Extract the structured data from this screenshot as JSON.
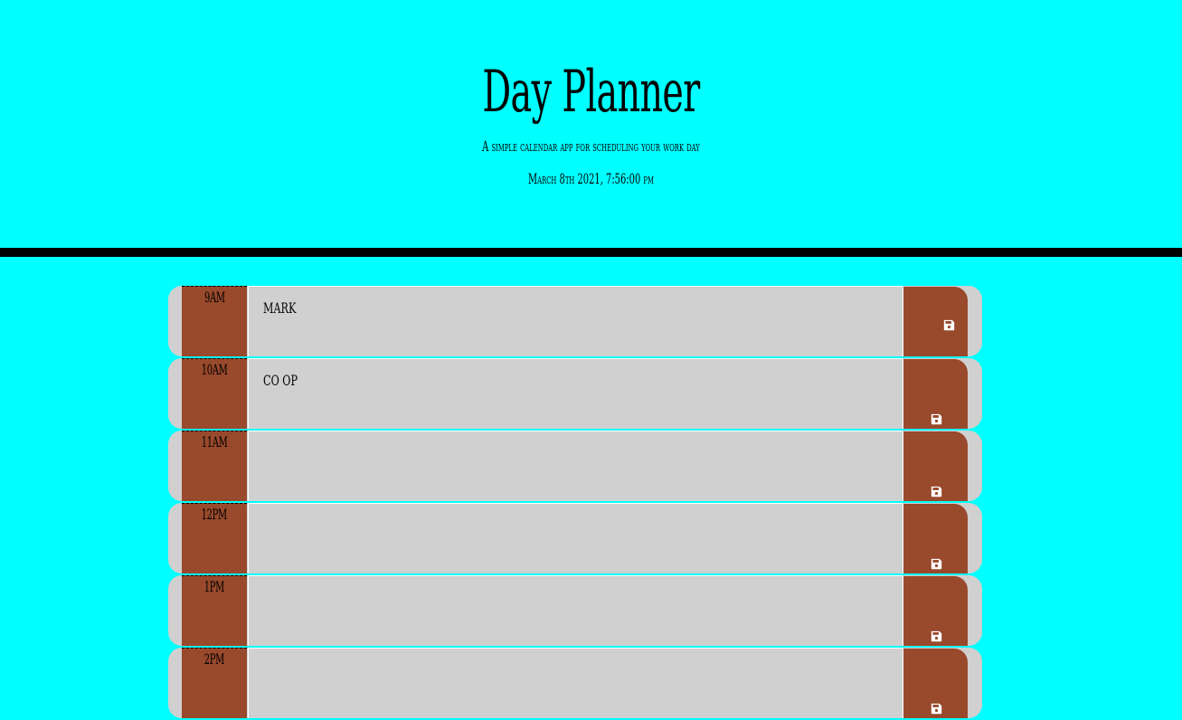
{
  "header": {
    "title": "Day Planner",
    "subtitle": "A simple calendar app for scheduling your work day",
    "current_datetime": "March 8th 2021, 7:56:00 pm"
  },
  "colors": {
    "background": "#00ffff",
    "divider": "#000000",
    "row_background": "#d0d0d0",
    "hour_block": "#99492c",
    "save_button": "#99492c",
    "icon": "#ffffff"
  },
  "rows": [
    {
      "hour": "9AM",
      "task": "mark",
      "save_icon": "floppy-disk-icon"
    },
    {
      "hour": "10AM",
      "task": "co op",
      "save_icon": "floppy-disk-icon"
    },
    {
      "hour": "11AM",
      "task": "",
      "save_icon": "floppy-disk-icon"
    },
    {
      "hour": "12PM",
      "task": "",
      "save_icon": "floppy-disk-icon"
    },
    {
      "hour": "1PM",
      "task": "",
      "save_icon": "floppy-disk-icon"
    },
    {
      "hour": "2PM",
      "task": "",
      "save_icon": "floppy-disk-icon"
    }
  ]
}
